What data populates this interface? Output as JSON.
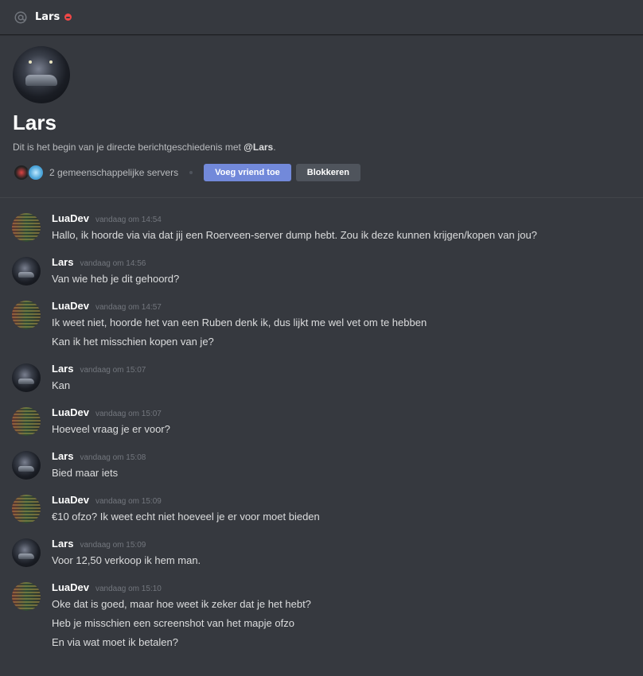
{
  "header": {
    "title": "Lars",
    "at_icon": "at-icon",
    "status": "do-not-disturb"
  },
  "intro": {
    "name": "Lars",
    "desc_prefix": "Dit is het begin van je directe berichtgeschiedenis met ",
    "desc_handle": "@Lars",
    "desc_suffix": ".",
    "mutual_servers": "2 gemeenschappelijke servers",
    "add_friend_label": "Voeg vriend toe",
    "block_label": "Blokkeren"
  },
  "messages": [
    {
      "author": "LuaDev",
      "avatar": "lua",
      "time": "vandaag om 14:54",
      "lines": [
        "Hallo, ik hoorde via via dat jij een Roerveen-server dump hebt. Zou ik deze kunnen krijgen/kopen van jou?"
      ]
    },
    {
      "author": "Lars",
      "avatar": "lars",
      "time": "vandaag om 14:56",
      "lines": [
        "Van wie heb je dit gehoord?"
      ]
    },
    {
      "author": "LuaDev",
      "avatar": "lua",
      "time": "vandaag om 14:57",
      "lines": [
        "Ik weet niet, hoorde het van een Ruben denk ik, dus lijkt me wel vet om te hebben",
        "Kan ik het misschien kopen van je?"
      ]
    },
    {
      "author": "Lars",
      "avatar": "lars",
      "time": "vandaag om 15:07",
      "lines": [
        "Kan"
      ]
    },
    {
      "author": "LuaDev",
      "avatar": "lua",
      "time": "vandaag om 15:07",
      "lines": [
        "Hoeveel vraag je er voor?"
      ]
    },
    {
      "author": "Lars",
      "avatar": "lars",
      "time": "vandaag om 15:08",
      "lines": [
        "Bied maar iets"
      ]
    },
    {
      "author": "LuaDev",
      "avatar": "lua",
      "time": "vandaag om 15:09",
      "lines": [
        "€10 ofzo? Ik weet echt niet hoeveel je er voor moet bieden"
      ]
    },
    {
      "author": "Lars",
      "avatar": "lars",
      "time": "vandaag om 15:09",
      "lines": [
        "Voor 12,50 verkoop ik hem man."
      ]
    },
    {
      "author": "LuaDev",
      "avatar": "lua",
      "time": "vandaag om 15:10",
      "lines": [
        "Oke dat is goed, maar hoe weet ik zeker dat je het hebt?",
        "Heb je misschien een screenshot van het mapje ofzo",
        "En via wat moet ik betalen?"
      ]
    }
  ],
  "colors": {
    "background": "#36393f",
    "header_border": "#202225",
    "accent": "#7289da",
    "secondary_button": "#4f545c",
    "dnd": "#f04747",
    "text": "#dcddde",
    "muted": "#72767d"
  }
}
